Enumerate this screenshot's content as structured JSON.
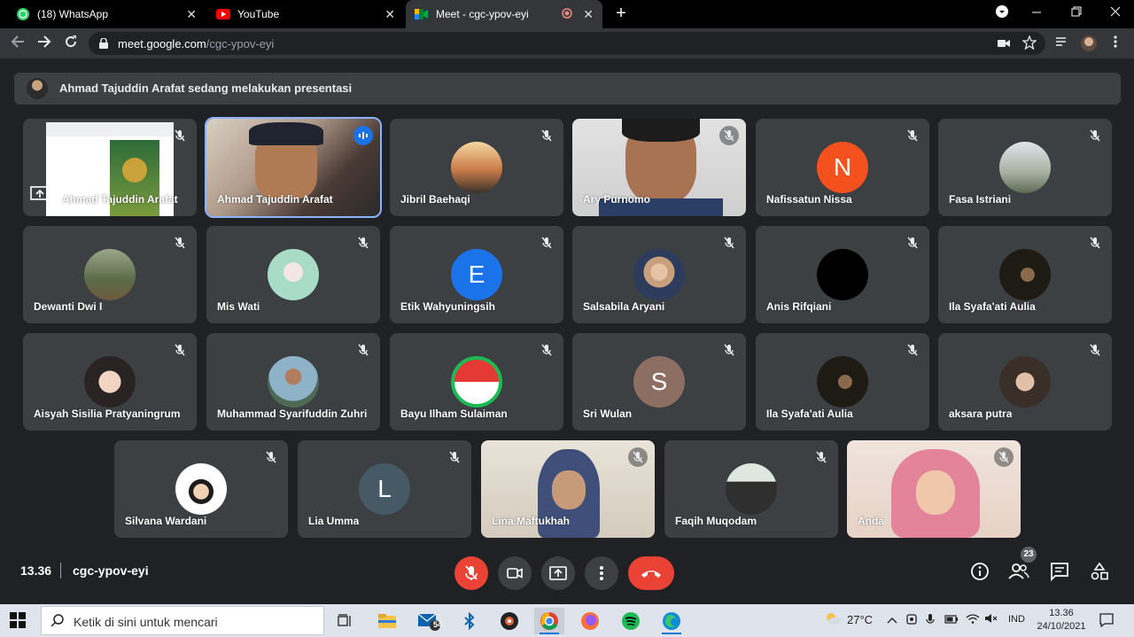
{
  "browser": {
    "tabs": [
      {
        "title": "(18) WhatsApp",
        "close": "✕"
      },
      {
        "title": "YouTube",
        "close": "✕"
      },
      {
        "title": "Meet - cgc-ypov-eyi",
        "close": "✕"
      }
    ],
    "new_tab": "+",
    "url_host": "meet.google.com",
    "url_path": "/cgc-ypov-eyi"
  },
  "presentation_banner": "Ahmad Tajuddin Arafat sedang melakukan presentasi",
  "participants": [
    {
      "name": "Ahmad Tajuddin Arafat",
      "type": "screen"
    },
    {
      "name": "Ahmad Tajuddin Arafat",
      "type": "video",
      "speaking": true
    },
    {
      "name": "Jibril Baehaqi",
      "type": "photo"
    },
    {
      "name": "Ary Purnomo",
      "type": "video"
    },
    {
      "name": "Nafissatun Nissa",
      "type": "letter",
      "letter": "N",
      "color": "#f4511e"
    },
    {
      "name": "Fasa Istriani",
      "type": "photo"
    },
    {
      "name": "Dewanti Dwi I",
      "type": "photo"
    },
    {
      "name": "Mis Wati",
      "type": "photo"
    },
    {
      "name": "Etik Wahyuningsih",
      "type": "letter",
      "letter": "E",
      "color": "#1a73e8"
    },
    {
      "name": "Salsabila Aryani",
      "type": "photo"
    },
    {
      "name": "Anis Rifqiani",
      "type": "photo"
    },
    {
      "name": "Ila Syafa'ati Aulia",
      "type": "photo"
    },
    {
      "name": "Aisyah Sisilia Pratyaningrum",
      "type": "photo"
    },
    {
      "name": "Muhammad Syarifuddin Zuhri",
      "type": "photo"
    },
    {
      "name": "Bayu Ilham Sulaiman",
      "type": "photo"
    },
    {
      "name": "Sri Wulan",
      "type": "letter",
      "letter": "S",
      "color": "#8d6e63"
    },
    {
      "name": "Ila Syafa'ati Aulia",
      "type": "photo"
    },
    {
      "name": "aksara putra",
      "type": "photo"
    },
    {
      "name": "Silvana Wardani",
      "type": "photo"
    },
    {
      "name": "Lia Umma",
      "type": "letter",
      "letter": "L",
      "color": "#455a64"
    },
    {
      "name": "Lina Maftukhah",
      "type": "video"
    },
    {
      "name": "Faqih Muqodam",
      "type": "photo"
    },
    {
      "name": "Anda",
      "type": "video"
    }
  ],
  "meeting": {
    "time": "13.36",
    "code": "cgc-ypov-eyi",
    "participant_count": "23"
  },
  "taskbar": {
    "search_placeholder": "Ketik di sini untuk mencari",
    "mail_badge": "54",
    "temperature": "27°C",
    "language": "IND",
    "time": "13.36",
    "date": "24/10/2021"
  }
}
